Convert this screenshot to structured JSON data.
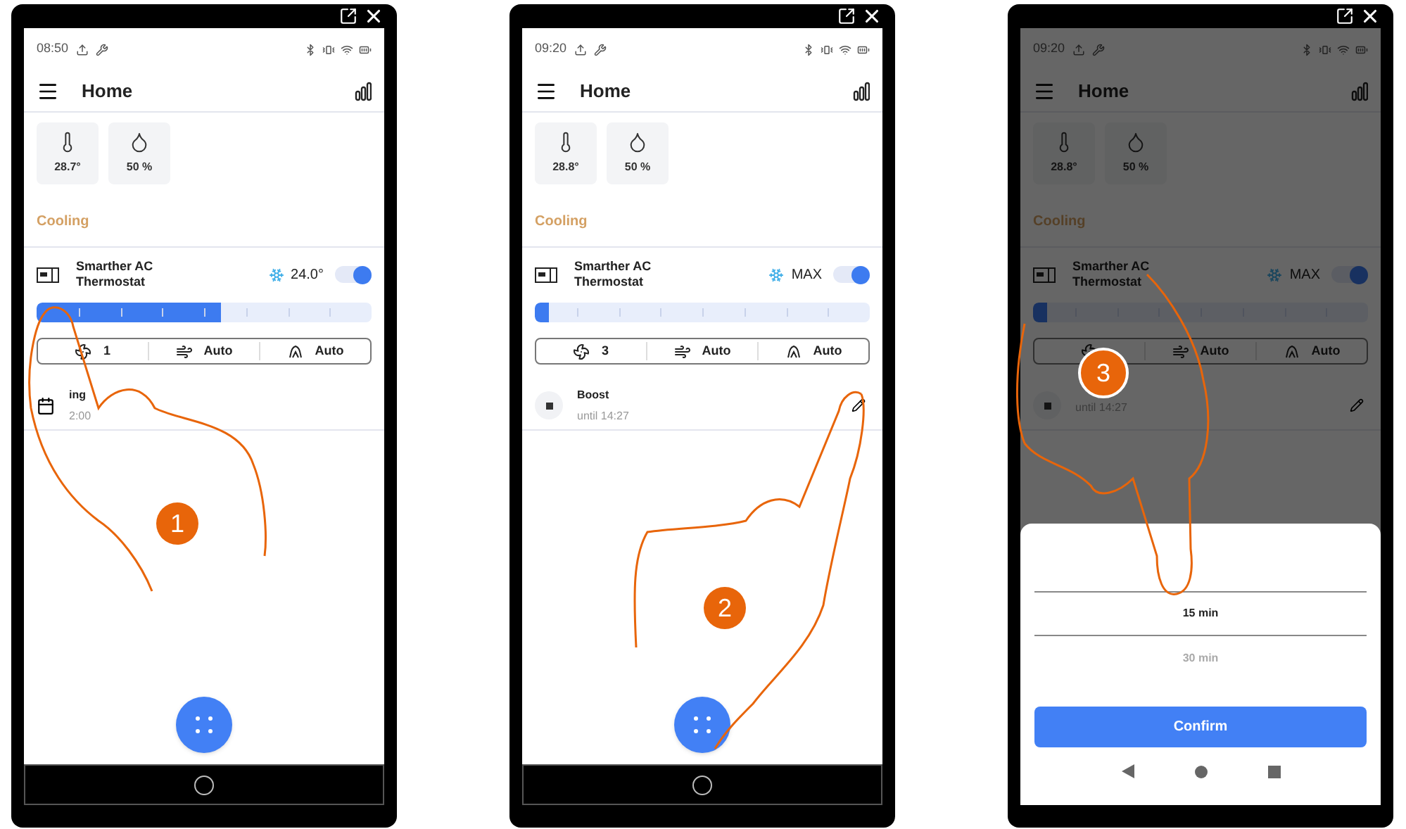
{
  "phones": [
    {
      "step": "1",
      "status_time": "08:50",
      "title": "Home",
      "sensors": [
        {
          "kind": "temperature",
          "value": "28.7°"
        },
        {
          "kind": "humidity",
          "value": "50 %"
        }
      ],
      "section": "Cooling",
      "device": {
        "name": "Smarther AC Thermostat",
        "reading": "24.0°",
        "on": true,
        "level": 0.55
      },
      "modes": [
        {
          "kind": "fan",
          "value": "1"
        },
        {
          "kind": "swing",
          "value": "Auto"
        },
        {
          "kind": "flap",
          "value": "Auto"
        }
      ],
      "program": {
        "kind": "schedule",
        "title": "ing",
        "subtitle": "2:00"
      },
      "fab": true,
      "dimmed": false,
      "nav": {
        "kind": "home"
      }
    },
    {
      "step": "2",
      "status_time": "09:20",
      "title": "Home",
      "sensors": [
        {
          "kind": "temperature",
          "value": "28.8°"
        },
        {
          "kind": "humidity",
          "value": "50 %"
        }
      ],
      "section": "Cooling",
      "device": {
        "name": "Smarther AC Thermostat",
        "reading": "MAX",
        "on": true,
        "level": 0.04
      },
      "modes": [
        {
          "kind": "fan",
          "value": "3"
        },
        {
          "kind": "swing",
          "value": "Auto"
        },
        {
          "kind": "flap",
          "value": "Auto"
        }
      ],
      "program": {
        "kind": "boost",
        "title": "Boost",
        "subtitle": "until 14:27",
        "editable": true
      },
      "fab": true,
      "dimmed": false,
      "nav": {
        "kind": "home"
      }
    },
    {
      "step": "3",
      "status_time": "09:20",
      "title": "Home",
      "sensors": [
        {
          "kind": "temperature",
          "value": "28.8°"
        },
        {
          "kind": "humidity",
          "value": "50 %"
        }
      ],
      "section": "Cooling",
      "device": {
        "name": "Smarther AC Thermostat",
        "reading": "MAX",
        "on": true,
        "level": 0.04
      },
      "modes": [
        {
          "kind": "fan"
        },
        {
          "kind": "swing",
          "value": "Auto"
        },
        {
          "kind": "flap",
          "value": "Auto"
        }
      ],
      "program": {
        "kind": "boost",
        "subtitle": "until 14:27",
        "editable": true
      },
      "fab": false,
      "dimmed": true,
      "sheet": {
        "options": [
          {
            "label": "15 min",
            "selected": true
          },
          {
            "label": "30 min",
            "selected": false
          }
        ],
        "button": "Confirm"
      },
      "nav": {
        "kind": "three-buttons"
      }
    }
  ]
}
